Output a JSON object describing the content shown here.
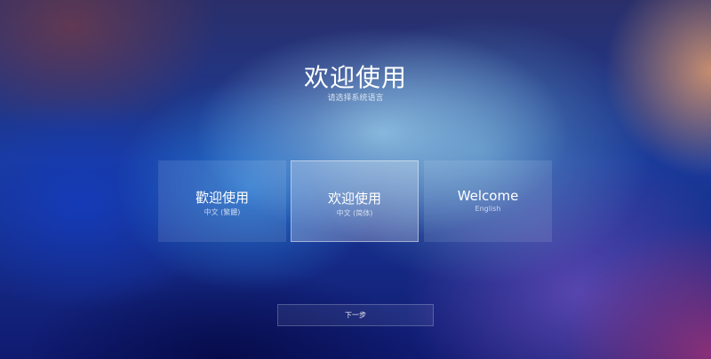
{
  "header": {
    "title": "欢迎使用",
    "subtitle": "请选择系统语言"
  },
  "languages": [
    {
      "title": "歡迎使用",
      "subtitle": "中文 (繁體)",
      "selected": false
    },
    {
      "title": "欢迎使用",
      "subtitle": "中文 (简体)",
      "selected": true
    },
    {
      "title": "Welcome",
      "subtitle": "English",
      "selected": false
    }
  ],
  "footer": {
    "next_label": "下一步"
  }
}
